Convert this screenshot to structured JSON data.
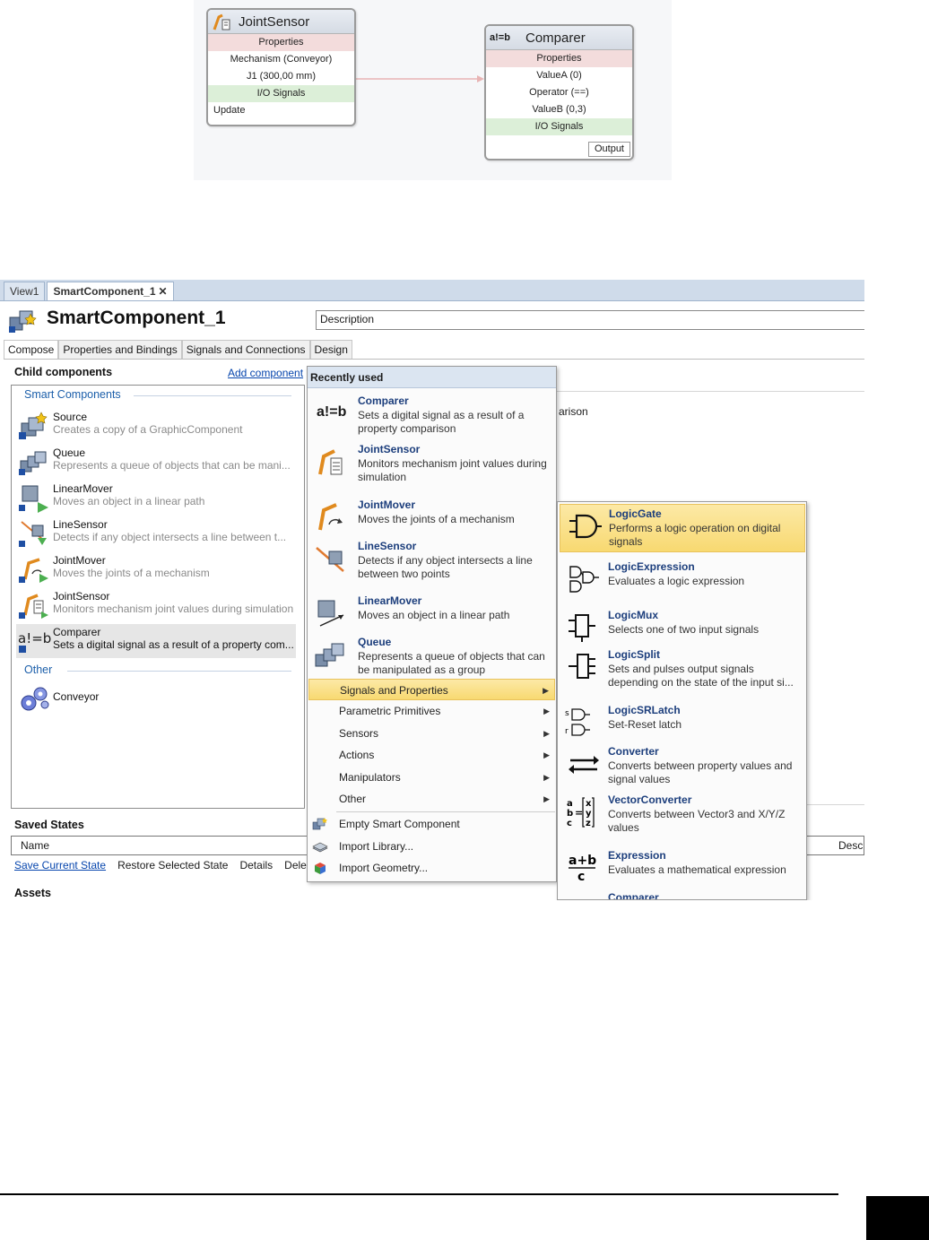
{
  "diagram": {
    "joint_sensor": {
      "title": "JointSensor",
      "rows": [
        "Properties",
        "Mechanism (Conveyor)",
        "J1 (300,00 mm)",
        "I/O Signals",
        "Update"
      ]
    },
    "comparer": {
      "badge": "a!=b",
      "title": "Comparer",
      "rows": [
        "Properties",
        "ValueA (0)",
        "Operator (==)",
        "ValueB (0,3)",
        "I/O Signals"
      ],
      "output": "Output"
    },
    "connector_color": "#e8b4b4"
  },
  "app": {
    "doc_tabs": [
      "View1",
      "SmartComponent_1"
    ],
    "close_glyph": "✕",
    "title": "SmartComponent_1",
    "description_value": "Description",
    "sub_tabs": [
      "Compose",
      "Properties and Bindings",
      "Signals and Connections",
      "Design"
    ],
    "child_components_label": "Child components",
    "add_component_label": "Add component",
    "groups": {
      "smart": "Smart Components",
      "other": "Other"
    },
    "components": [
      {
        "name": "Source",
        "desc": "Creates a copy of a GraphicComponent",
        "icon": "source-icon"
      },
      {
        "name": "Queue",
        "desc": "Represents a queue of objects that can be mani...",
        "icon": "queue-icon"
      },
      {
        "name": "LinearMover",
        "desc": "Moves an object in a linear path",
        "icon": "linear-mover-icon"
      },
      {
        "name": "LineSensor",
        "desc": "Detects if any object intersects a line between t...",
        "icon": "line-sensor-icon"
      },
      {
        "name": "JointMover",
        "desc": "Moves the joints of a mechanism",
        "icon": "joint-mover-icon"
      },
      {
        "name": "JointSensor",
        "desc": "Monitors mechanism joint values during simulation",
        "icon": "joint-sensor-icon"
      },
      {
        "name": "Comparer",
        "desc": "Sets a digital signal as a result of a property com...",
        "icon": "comparer-icon",
        "badge": "a!=b"
      }
    ],
    "other_components": [
      {
        "name": "Conveyor",
        "icon": "gears-icon"
      }
    ],
    "partial_text": "arison",
    "saved_states_label": "Saved States",
    "saved_table": {
      "col_name": "Name",
      "col_desc": "Desc"
    },
    "saved_actions": [
      "Save Current State",
      "Restore Selected State",
      "Details",
      "Delete"
    ],
    "assets_label": "Assets"
  },
  "menu1": {
    "header": "Recently used",
    "recent": [
      {
        "title": "Comparer",
        "desc": "Sets a digital signal as a result of a property comparison",
        "icon": "comparer-icon",
        "badge": "a!=b"
      },
      {
        "title": "JointSensor",
        "desc": "Monitors mechanism joint values during simulation",
        "icon": "joint-sensor-icon"
      },
      {
        "title": "JointMover",
        "desc": "Moves the joints of a mechanism",
        "icon": "joint-mover-icon"
      },
      {
        "title": "LineSensor",
        "desc": "Detects if any object intersects a line between two points",
        "icon": "line-sensor-icon"
      },
      {
        "title": "LinearMover",
        "desc": "Moves an object in a linear path",
        "icon": "linear-mover-icon"
      },
      {
        "title": "Queue",
        "desc": "Represents a queue of objects that can be manipulated as a group",
        "icon": "queue-icon"
      }
    ],
    "submenus": [
      "Signals and Properties",
      "Parametric Primitives",
      "Sensors",
      "Actions",
      "Manipulators",
      "Other"
    ],
    "actions": [
      "Empty Smart Component",
      "Import Library...",
      "Import Geometry..."
    ],
    "arrow_glyph": "▶"
  },
  "menu2": {
    "items": [
      {
        "title": "LogicGate",
        "desc": "Performs a logic operation on digital signals",
        "icon": "logic-gate-icon"
      },
      {
        "title": "LogicExpression",
        "desc": "Evaluates a logic expression",
        "icon": "logic-expression-icon"
      },
      {
        "title": "LogicMux",
        "desc": "Selects one of two input signals",
        "icon": "logic-mux-icon"
      },
      {
        "title": "LogicSplit",
        "desc": "Sets and pulses output signals depending on the state of the input si...",
        "icon": "logic-split-icon"
      },
      {
        "title": "LogicSRLatch",
        "desc": "Set-Reset latch",
        "icon": "sr-latch-icon"
      },
      {
        "title": "Converter",
        "desc": "Converts between property values and signal values",
        "icon": "converter-icon"
      },
      {
        "title": "VectorConverter",
        "desc": "Converts between Vector3 and X/Y/Z values",
        "icon": "vector-converter-icon"
      },
      {
        "title": "Expression",
        "desc": "Evaluates a mathematical expression",
        "icon": "expression-icon"
      },
      {
        "title": "Comparer",
        "desc": "",
        "icon": "comparer-icon"
      }
    ],
    "highlight_color": "#f8d971"
  }
}
